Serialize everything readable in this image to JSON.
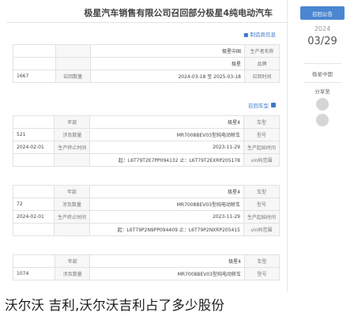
{
  "page_title": "极星汽车销售有限公司召回部分极星4纯电动汽车",
  "section_basic": "■ 制造商信息",
  "section_recall": "召回车型",
  "basic_rows": [
    [
      "生产者名称",
      "极星中国",
      "",
      ""
    ],
    [
      "品牌",
      "极星",
      "",
      ""
    ],
    [
      "召回时间",
      "2024-03-18 至 2025-03-18",
      "召回数量",
      "1667"
    ]
  ],
  "model_blocks": [
    {
      "rows": [
        [
          "车型",
          "极星4",
          "年款",
          ""
        ],
        [
          "型号",
          "MR7008BEV03型纯电动轿车",
          "涉及数量",
          "521"
        ],
        [
          "生产起始时间",
          "2023-11-29",
          "生产终止时间",
          "2024-02-01"
        ],
        [
          "vin码范围",
          "起：L6T79T2E7PP094132 止：L6T79T2EXRP205178",
          "",
          ""
        ]
      ]
    },
    {
      "rows": [
        [
          "车型",
          "极星4",
          "年款",
          ""
        ],
        [
          "型号",
          "MR7008BEV03型纯电动轿车",
          "涉及数量",
          "72"
        ],
        [
          "生产起始时间",
          "2023-11-29",
          "生产终止时间",
          "2024-02-01"
        ],
        [
          "vin码范围",
          "起：L6T79P2N9PP094409 止：L6T79P2NXRP205415",
          "",
          ""
        ]
      ]
    },
    {
      "rows": [
        [
          "车型",
          "极星4",
          "年款",
          ""
        ],
        [
          "型号",
          "MR7008BEV03型纯电动轿车",
          "涉及数量",
          "1074"
        ]
      ]
    }
  ],
  "sidebar": {
    "button_label": "召回公告",
    "year": "2024",
    "month_day": "03/29",
    "brand": "极星中国",
    "share_label": "分享至"
  },
  "caption": "沃尔沃 吉利,沃尔沃吉利占了多少股份"
}
